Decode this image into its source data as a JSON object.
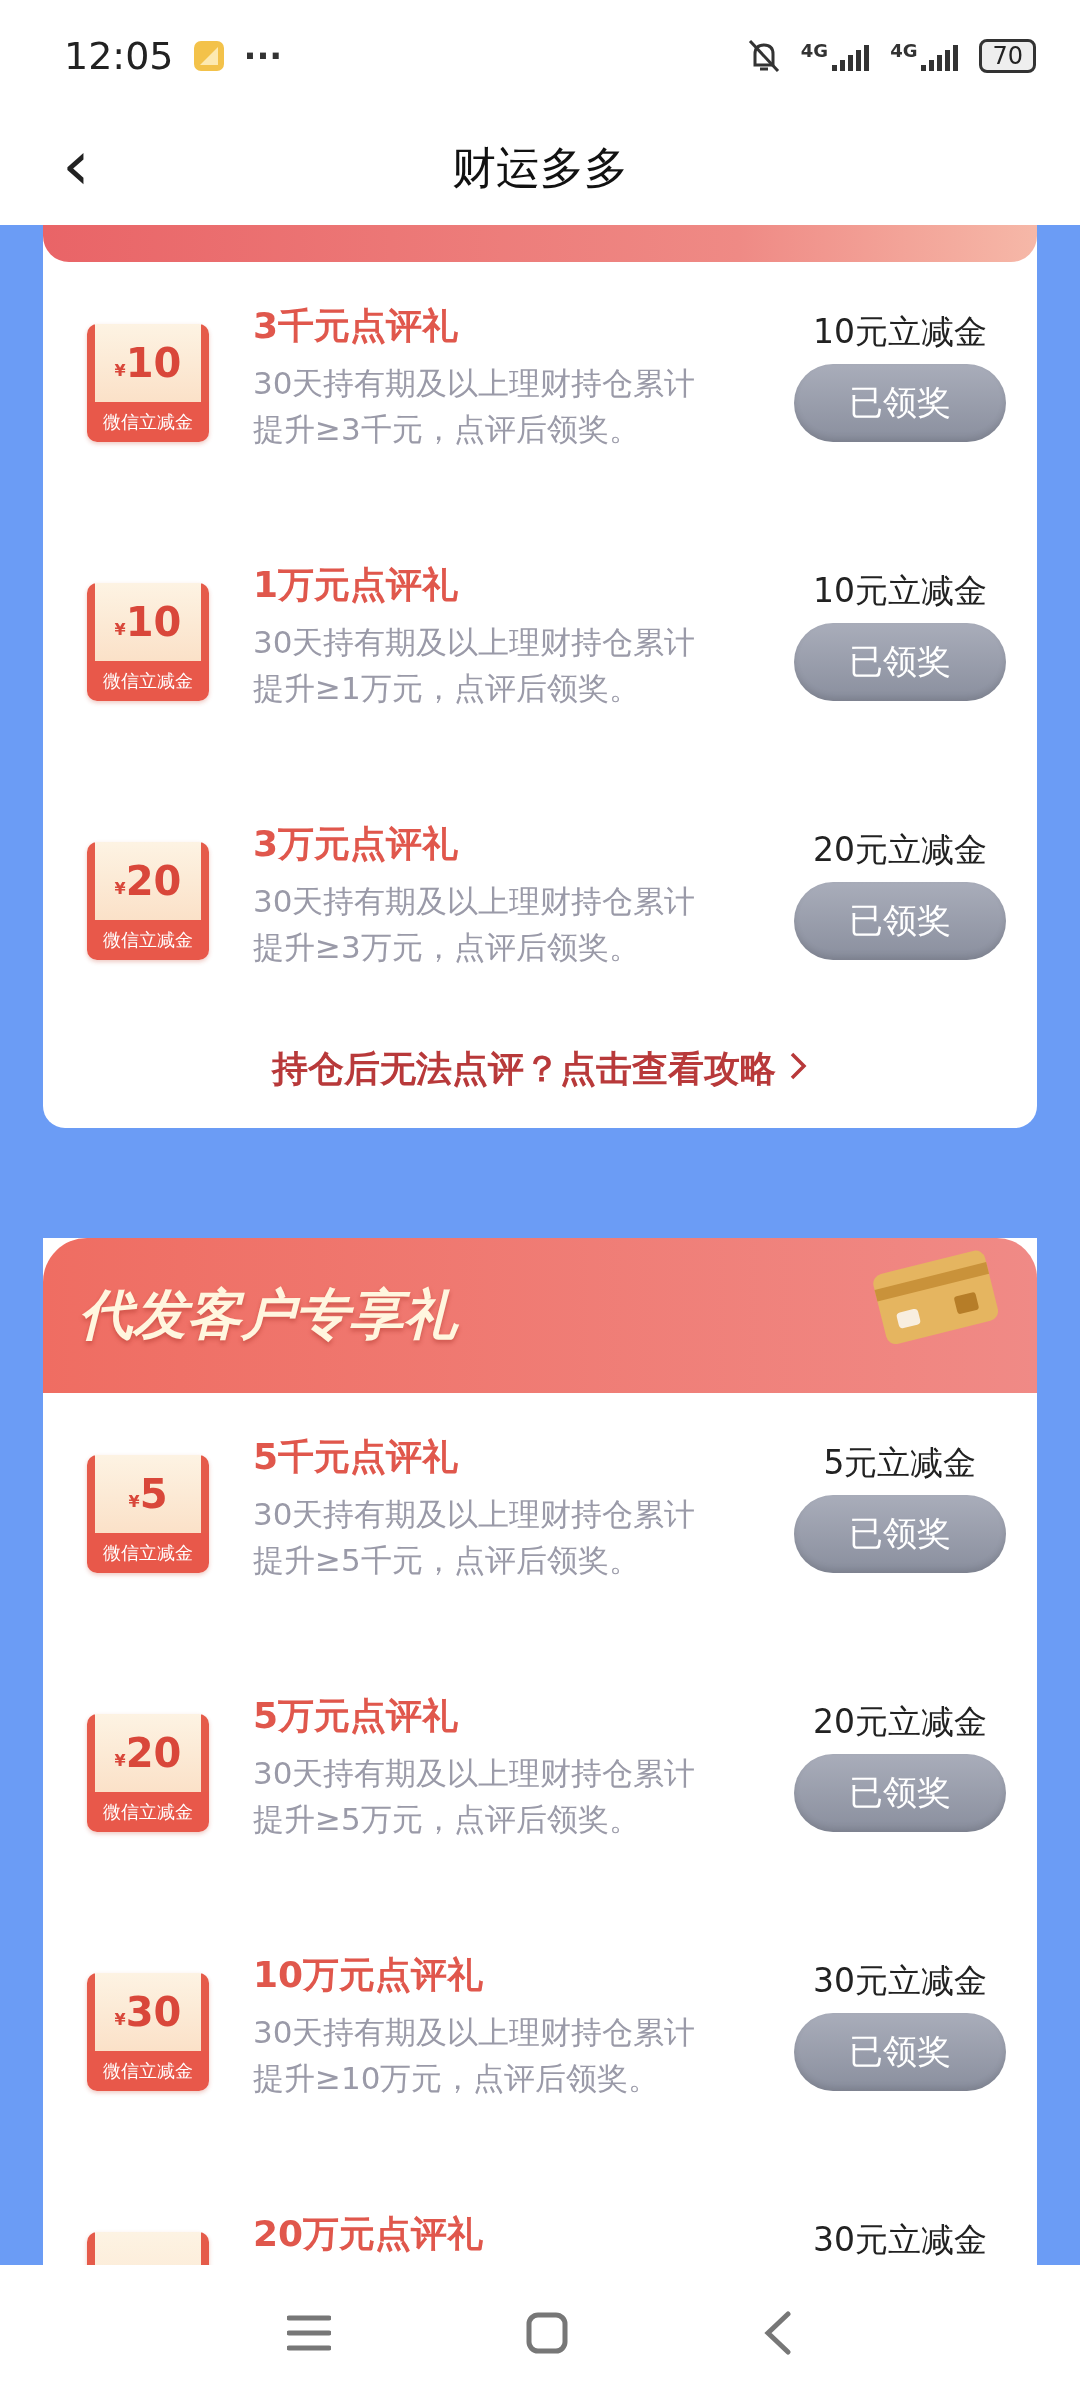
{
  "status_bar": {
    "time": "12:05",
    "more": "···",
    "network_1": "4G",
    "network_2": "4G",
    "battery": "70"
  },
  "header": {
    "back": "‹",
    "title": "财运多多"
  },
  "sections": [
    {
      "items": [
        {
          "coupon_currency": "¥",
          "coupon_amount": "10",
          "coupon_label": "微信立减金",
          "title": "3千元点评礼",
          "description": "30天持有期及以上理财持仓累计提升≥3千元，点评后领奖。",
          "reward": "10元立减金",
          "button": "已领奖",
          "claimed": true
        },
        {
          "coupon_currency": "¥",
          "coupon_amount": "10",
          "coupon_label": "微信立减金",
          "title": "1万元点评礼",
          "description": "30天持有期及以上理财持仓累计提升≥1万元，点评后领奖。",
          "reward": "10元立减金",
          "button": "已领奖",
          "claimed": true
        },
        {
          "coupon_currency": "¥",
          "coupon_amount": "20",
          "coupon_label": "微信立减金",
          "title": "3万元点评礼",
          "description": "30天持有期及以上理财持仓累计提升≥3万元，点评后领奖。",
          "reward": "20元立减金",
          "button": "已领奖",
          "claimed": true
        }
      ],
      "footer_link": "持仓后无法点评？点击查看攻略"
    },
    {
      "title": "代发客户专享礼",
      "items": [
        {
          "coupon_currency": "¥",
          "coupon_amount": "5",
          "coupon_label": "微信立减金",
          "title": "5千元点评礼",
          "description": "30天持有期及以上理财持仓累计提升≥5千元，点评后领奖。",
          "reward": "5元立减金",
          "button": "已领奖",
          "claimed": true
        },
        {
          "coupon_currency": "¥",
          "coupon_amount": "20",
          "coupon_label": "微信立减金",
          "title": "5万元点评礼",
          "description": "30天持有期及以上理财持仓累计提升≥5万元，点评后领奖。",
          "reward": "20元立减金",
          "button": "已领奖",
          "claimed": true
        },
        {
          "coupon_currency": "¥",
          "coupon_amount": "30",
          "coupon_label": "微信立减金",
          "title": "10万元点评礼",
          "description": "30天持有期及以上理财持仓累计提升≥10万元，点评后领奖。",
          "reward": "30元立减金",
          "button": "已领奖",
          "claimed": true
        },
        {
          "title": "20万元点评礼",
          "reward": "30元立减金"
        }
      ]
    }
  ]
}
